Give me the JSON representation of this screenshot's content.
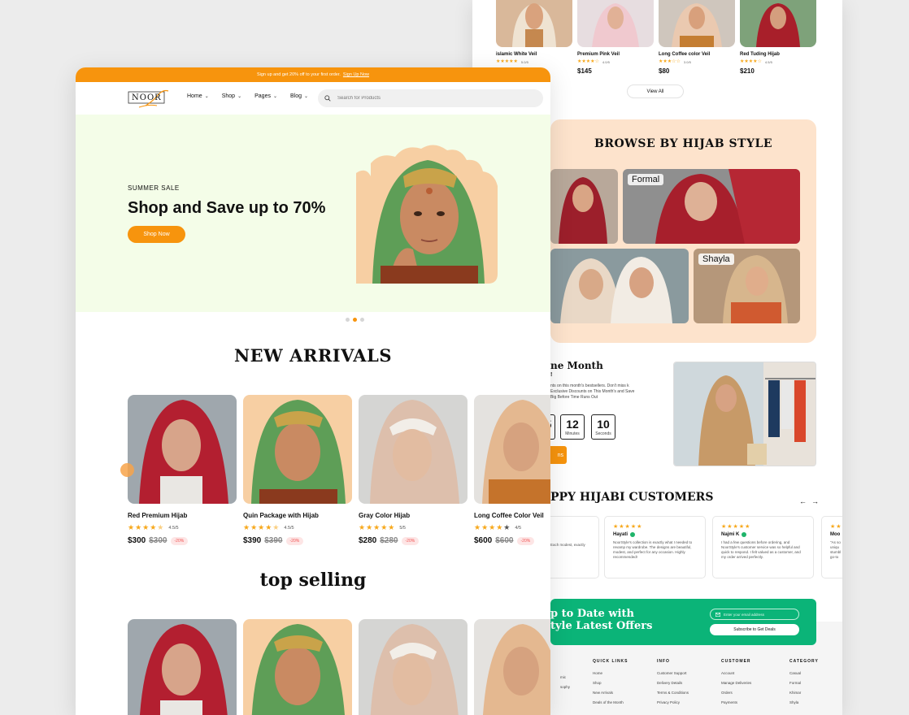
{
  "colors": {
    "accent": "#f7940d",
    "hero_bg": "#f4fde8",
    "browse_bg": "#fde3cc",
    "newsletter_bg": "#0bb478",
    "star": "#f7a81b"
  },
  "back_page": {
    "products": [
      {
        "name": "islamic White Veil",
        "rating": "5.0/5",
        "price": ""
      },
      {
        "name": "Premium Pink Veil",
        "rating": "4.0/5",
        "price": "$145"
      },
      {
        "name": "Long Coffee color Veil",
        "rating": "3.0/5",
        "price": "$80"
      },
      {
        "name": "Red Tuding Hijab",
        "rating": "4.5/5",
        "price": "$210"
      }
    ],
    "view_all": "View All",
    "browse_title": "BROWSE BY HIJAB STYLE",
    "styles": [
      "Formal",
      "Shayla"
    ],
    "deal": {
      "title": "ne Month",
      "subtitle": "!",
      "desc": "nts on this month's bestsellers. Don't miss k Exclusive Discounts on This Month's and Save Big Before Time Runs Out",
      "countdown": [
        {
          "value": "5",
          "label": ""
        },
        {
          "value": "12",
          "label": "Minutes"
        },
        {
          "value": "10",
          "label": "Seconds"
        }
      ],
      "button": "ns"
    },
    "customers_title": "PPY HIJABI CUSTOMERS",
    "arrows": {
      "prev": "←",
      "next": "→"
    },
    "reviews": [
      {
        "name": "",
        "text": "th the quality and is clothing. Each modest, exactly what I ly be ordering again!"
      },
      {
        "name": "Hayati",
        "text": "NoorStyle's collection is exactly what I needed to revamp my wardrobe. The designs are beautiful, modest, and perfect for any occasion. Highly recommended!"
      },
      {
        "name": "Najmi K",
        "text": "I had a few questions before ordering, and NoorStyle's customer service was so helpful and quick to respond. I felt valued as a customer, and my order arrived perfectly."
      },
      {
        "name": "Moo",
        "text": "\"As so uniqu stumbl go-to"
      }
    ],
    "newsletter": {
      "title_line1": "p to Date with",
      "title_line2": "tyle Latest Offers",
      "email_placeholder": "Enter your email address",
      "button": "Subscribe to Get Deals"
    },
    "footer": {
      "partial": [
        "mic",
        "sophy"
      ],
      "columns": [
        {
          "title": "QUICK LINKS",
          "items": [
            "Home",
            "Shop",
            "New Arrivals",
            "Deals of the Month"
          ]
        },
        {
          "title": "INFO",
          "items": [
            "Customer Support",
            "Delivery Details",
            "Terms & Conditions",
            "Privacy Policy"
          ]
        },
        {
          "title": "CUSTOMER",
          "items": [
            "Account",
            "Manage Deliveries",
            "Orders",
            "Payments"
          ]
        },
        {
          "title": "CATEGORY",
          "items": [
            "Casual",
            "Formal",
            "Khimar",
            "Shyla"
          ]
        }
      ]
    }
  },
  "front_page": {
    "topbar": {
      "text": "Sign up and get 20% off to your first order.",
      "link": "Sign Up Now"
    },
    "logo": "NOOR",
    "nav": [
      "Home",
      "Shop",
      "Pages",
      "Blog"
    ],
    "search_placeholder": "Search for Products",
    "hero": {
      "kicker": "SUMMER SALE",
      "title": "Shop and Save up to 70%",
      "button": "Shop Now"
    },
    "new_arrivals_title": "NEW ARRIVALS",
    "new_arrivals": [
      {
        "name": "Red Premium Hijab",
        "stars": 4.5,
        "rating": "4.5/5",
        "price": "$300",
        "old_price": "$300",
        "discount": "-20%"
      },
      {
        "name": "Quin Package with Hijab",
        "stars": 4.5,
        "rating": "4.5/5",
        "price": "$390",
        "old_price": "$390",
        "discount": "-20%"
      },
      {
        "name": "Gray Color Hijab",
        "stars": 5,
        "rating": "5/5",
        "price": "$280",
        "old_price": "$280",
        "discount": "-20%"
      },
      {
        "name": "Long Coffee Color Veil",
        "stars": 4,
        "rating": "4/5",
        "price": "$600",
        "old_price": "$600",
        "discount": "-20%"
      }
    ],
    "top_selling_title": "top selling"
  }
}
